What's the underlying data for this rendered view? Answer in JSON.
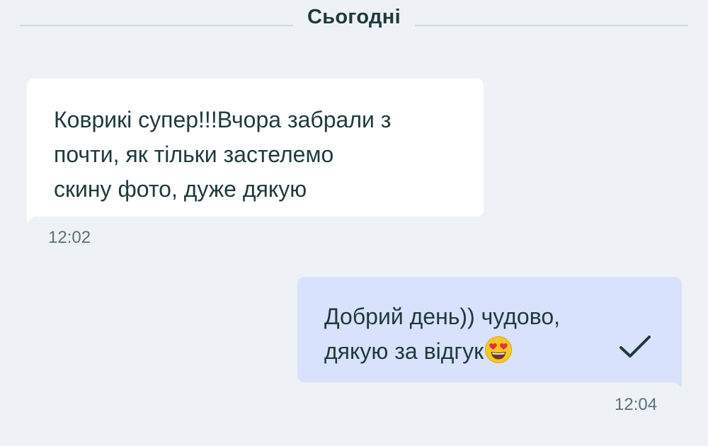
{
  "chat": {
    "date_label": "Сьогодні",
    "messages": [
      {
        "direction": "incoming",
        "text": "Коврикі супер!!!Вчора забрали з\nпочти, як тільки застелемо\nскину фото, дуже дякую",
        "time": "12:02"
      },
      {
        "direction": "outgoing",
        "text": "Добрий день)) чудово,\nдякую за відгук",
        "emoji": "heart-eyes-emoji",
        "time": "12:04",
        "status": "sent-check-icon"
      }
    ]
  },
  "colors": {
    "background": "#eef2f6",
    "incoming_bubble": "#ffffff",
    "outgoing_bubble": "#d9e2fd",
    "text": "#1f3a3c",
    "time": "#5c7275"
  }
}
